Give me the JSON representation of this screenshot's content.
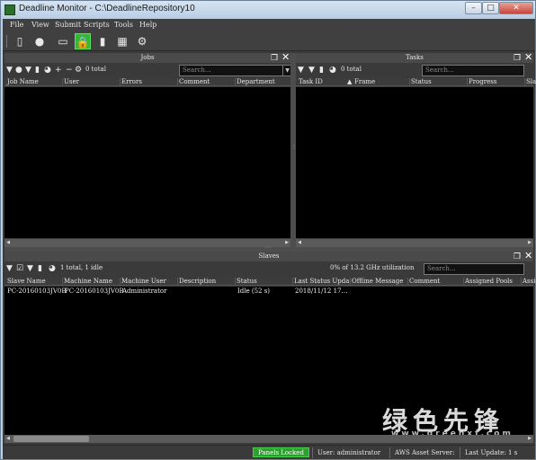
{
  "window": {
    "title": "Deadline Monitor  -  C:\\DeadlineRepository10",
    "controls": {
      "minimize": "–",
      "maximize": "□",
      "close": "✕"
    }
  },
  "menu": [
    "File",
    "View",
    "Submit",
    "Scripts",
    "Tools",
    "Help"
  ],
  "toolbar": {
    "icons": [
      "monitor-icon",
      "user-icon",
      "window-icon",
      "lock-icon",
      "bookmark-icon",
      "options-icon",
      "settings-icon"
    ],
    "active": "lock-icon",
    "accent": "#37b43a"
  },
  "jobs": {
    "title": "Jobs",
    "count_text": "0 total",
    "search_placeholder": "Search...",
    "columns": [
      "Job Name",
      "User",
      "Errors",
      "Comment",
      "Department"
    ]
  },
  "tasks": {
    "title": "Tasks",
    "count_text": "0 total",
    "search_placeholder": "Search...",
    "sort_arrow": "▲",
    "columns": [
      "Task ID",
      "Frame",
      "Status",
      "Progress",
      "Sla"
    ]
  },
  "slaves": {
    "title": "Slaves",
    "count_text": "1 total, 1 idle",
    "utilization_text": "0% of 13.2 GHz utilization",
    "search_placeholder": "Search...",
    "columns": [
      "Slave Name",
      "Machine Name",
      "Machine User",
      "Description",
      "Status",
      "Last Status Upda",
      "Offline Message",
      "Comment",
      "Assigned Pools",
      "Assi"
    ],
    "rows": [
      {
        "slave_name": "PC-20160103JV0B",
        "machine_name": "PC-20160103JV0B",
        "machine_user": "Administrator",
        "description": "",
        "status": "Idle (52 s)",
        "last_status_update": "2018/11/12 17…"
      }
    ]
  },
  "status_bar": {
    "panels_locked": "Panels Locked",
    "user": "User: administrator",
    "aws": "AWS Asset Server:",
    "last_update": "Last Update: 1 s",
    "badge_color": "#2ea031"
  },
  "watermark": {
    "chinese": "绿色先锋",
    "url": "www.greenxf.com"
  }
}
